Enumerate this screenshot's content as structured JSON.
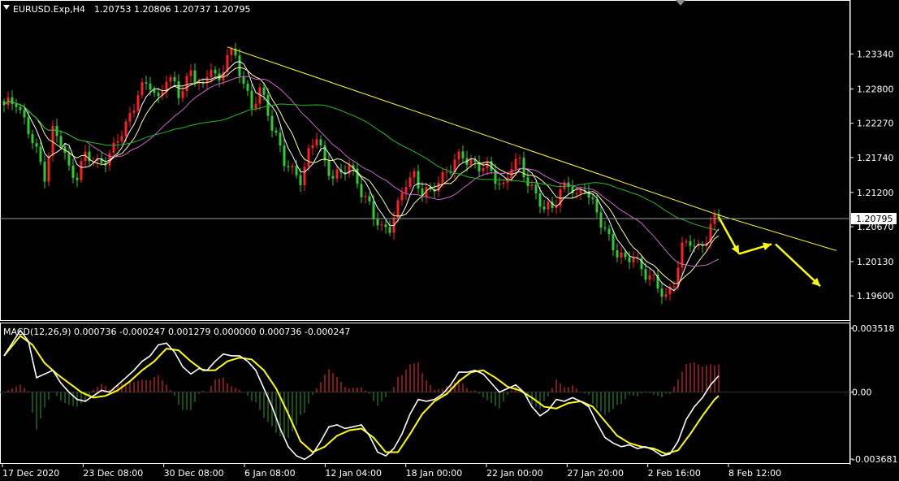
{
  "main_header": {
    "symbol": "EURUSD.Exp,H4",
    "ohlc": "1.20753 1.20806 1.20737 1.20795"
  },
  "macd_header": {
    "label": "MACD(12,26,9) 0.000736 -0.000247 0.001279 0.000000 0.000736 -0.000247"
  },
  "current_price": "1.20795",
  "colors": {
    "background": "#000000",
    "bull": "#ff2020",
    "bear": "#2ecc2e",
    "ma_fast": "#ffffff",
    "ma_mid": "#ffff99",
    "ma_slow": "#cc66cc",
    "ma_long": "#22bb22",
    "trendline": "#ffff33",
    "arrows": "#ffff00",
    "macd_line": "#ffffff",
    "signal_line": "#ffff00",
    "hist_pos": "#aa2222",
    "hist_neg": "#1f6b1f"
  },
  "chart_data": [
    {
      "type": "candlestick",
      "title": "EURUSD.Exp,H4",
      "price_ticks": [
        "1.23340",
        "1.22800",
        "1.22270",
        "1.21740",
        "1.21200",
        "1.20670",
        "1.20130",
        "1.19600"
      ],
      "ylim": [
        1.193,
        1.239
      ],
      "time_ticks": [
        "17 Dec 2020",
        "23 Dec 08:00",
        "30 Dec 08:00",
        "6 Jan 08:00",
        "12 Jan 04:00",
        "18 Jan 00:00",
        "22 Jan 00:00",
        "27 Jan 20:00",
        "2 Feb 16:00",
        "8 Feb 12:00"
      ],
      "close_anchors": [
        [
          0,
          1.225
        ],
        [
          3,
          1.2265
        ],
        [
          5,
          1.223
        ],
        [
          8,
          1.218
        ],
        [
          10,
          1.215
        ],
        [
          12,
          1.2215
        ],
        [
          14,
          1.2195
        ],
        [
          16,
          1.2155
        ],
        [
          18,
          1.215
        ],
        [
          20,
          1.2175
        ],
        [
          23,
          1.2165
        ],
        [
          27,
          1.2185
        ],
        [
          30,
          1.2225
        ],
        [
          33,
          1.2275
        ],
        [
          36,
          1.2285
        ],
        [
          38,
          1.2265
        ],
        [
          40,
          1.23
        ],
        [
          43,
          1.227
        ],
        [
          46,
          1.231
        ],
        [
          49,
          1.2275
        ],
        [
          51,
          1.232
        ],
        [
          53,
          1.229
        ],
        [
          55,
          1.2335
        ],
        [
          57,
          1.2325
        ],
        [
          59,
          1.2295
        ],
        [
          61,
          1.225
        ],
        [
          63,
          1.2275
        ],
        [
          65,
          1.2245
        ],
        [
          67,
          1.221
        ],
        [
          69,
          1.2165
        ],
        [
          71,
          1.215
        ],
        [
          73,
          1.2145
        ],
        [
          75,
          1.218
        ],
        [
          77,
          1.2205
        ],
        [
          79,
          1.2165
        ],
        [
          81,
          1.215
        ],
        [
          83,
          1.2145
        ],
        [
          85,
          1.216
        ],
        [
          87,
          1.214
        ],
        [
          89,
          1.211
        ],
        [
          91,
          1.208
        ],
        [
          93,
          1.2065
        ],
        [
          95,
          1.207
        ],
        [
          97,
          1.2095
        ],
        [
          99,
          1.2135
        ],
        [
          101,
          1.215
        ],
        [
          103,
          1.212
        ],
        [
          105,
          1.2115
        ],
        [
          107,
          1.214
        ],
        [
          109,
          1.2155
        ],
        [
          111,
          1.2165
        ],
        [
          113,
          1.2175
        ],
        [
          115,
          1.217
        ],
        [
          117,
          1.216
        ],
        [
          119,
          1.2155
        ],
        [
          121,
          1.2145
        ],
        [
          123,
          1.213
        ],
        [
          125,
          1.216
        ],
        [
          127,
          1.2165
        ],
        [
          129,
          1.214
        ],
        [
          131,
          1.2115
        ],
        [
          133,
          1.209
        ],
        [
          135,
          1.21
        ],
        [
          137,
          1.2125
        ],
        [
          139,
          1.213
        ],
        [
          141,
          1.211
        ],
        [
          143,
          1.2135
        ],
        [
          145,
          1.21
        ],
        [
          147,
          1.207
        ],
        [
          149,
          1.205
        ],
        [
          151,
          1.203
        ],
        [
          153,
          1.201
        ],
        [
          155,
          1.202
        ],
        [
          157,
          1.2005
        ],
        [
          159,
          1.199
        ],
        [
          161,
          1.197
        ],
        [
          163,
          1.196
        ],
        [
          165,
          1.1985
        ],
        [
          167,
          1.203
        ],
        [
          169,
          1.2045
        ],
        [
          171,
          1.2035
        ],
        [
          173,
          1.205
        ],
        [
          175,
          1.2075
        ],
        [
          176,
          1.2079
        ]
      ],
      "trendline": [
        [
          55,
          1.2345
        ],
        [
          176,
          1.2085
        ],
        [
          205,
          1.203
        ]
      ],
      "forecast_arrows": [
        [
          [
            176,
            1.2082
          ],
          [
            181,
            1.2025
          ]
        ],
        [
          [
            181,
            1.2025
          ],
          [
            189,
            1.204
          ]
        ],
        [
          [
            190,
            1.204
          ],
          [
            201,
            1.1975
          ]
        ]
      ]
    },
    {
      "type": "histogram+line",
      "title": "MACD(12,26,9)",
      "scale_ticks": [
        "0.003518",
        "0.00",
        "-0.003681"
      ],
      "ylim": [
        -0.003681,
        0.003518
      ],
      "macd_anchors": [
        [
          0,
          0.002
        ],
        [
          4,
          0.0034
        ],
        [
          6,
          0.0028
        ],
        [
          8,
          0.0008
        ],
        [
          10,
          0.001
        ],
        [
          12,
          0.0012
        ],
        [
          14,
          0.0005
        ],
        [
          16,
          0.0
        ],
        [
          18,
          -0.0004
        ],
        [
          20,
          -0.0005
        ],
        [
          22,
          -0.0002
        ],
        [
          24,
          0.0001
        ],
        [
          26,
          0.0
        ],
        [
          28,
          0.0004
        ],
        [
          30,
          0.0008
        ],
        [
          32,
          0.0012
        ],
        [
          34,
          0.0017
        ],
        [
          36,
          0.002
        ],
        [
          38,
          0.0026
        ],
        [
          40,
          0.0027
        ],
        [
          42,
          0.0022
        ],
        [
          44,
          0.0014
        ],
        [
          46,
          0.001
        ],
        [
          48,
          0.0013
        ],
        [
          50,
          0.0012
        ],
        [
          52,
          0.0017
        ],
        [
          54,
          0.0021
        ],
        [
          56,
          0.002
        ],
        [
          58,
          0.002
        ],
        [
          60,
          0.0017
        ],
        [
          62,
          0.0012
        ],
        [
          64,
          0.0002
        ],
        [
          66,
          -0.0008
        ],
        [
          68,
          -0.002
        ],
        [
          70,
          -0.003
        ],
        [
          72,
          -0.0035
        ],
        [
          74,
          -0.0037
        ],
        [
          76,
          -0.0034
        ],
        [
          78,
          -0.0027
        ],
        [
          80,
          -0.0019
        ],
        [
          82,
          -0.0018
        ],
        [
          84,
          -0.002
        ],
        [
          86,
          -0.0019
        ],
        [
          88,
          -0.0018
        ],
        [
          90,
          -0.0024
        ],
        [
          92,
          -0.0033
        ],
        [
          94,
          -0.0035
        ],
        [
          96,
          -0.0031
        ],
        [
          98,
          -0.0023
        ],
        [
          100,
          -0.0012
        ],
        [
          102,
          -0.0004
        ],
        [
          104,
          -0.0005
        ],
        [
          106,
          -0.0004
        ],
        [
          108,
          -0.0001
        ],
        [
          110,
          0.0004
        ],
        [
          112,
          0.0011
        ],
        [
          114,
          0.0011
        ],
        [
          116,
          0.0012
        ],
        [
          118,
          0.001
        ],
        [
          120,
          0.0005
        ],
        [
          122,
          0.0
        ],
        [
          124,
          0.0002
        ],
        [
          126,
          0.0004
        ],
        [
          128,
          0.0
        ],
        [
          130,
          -0.0008
        ],
        [
          132,
          -0.0013
        ],
        [
          134,
          -0.001
        ],
        [
          136,
          -0.0004
        ],
        [
          138,
          -0.0005
        ],
        [
          140,
          -0.0003
        ],
        [
          142,
          -0.0005
        ],
        [
          144,
          -0.0008
        ],
        [
          146,
          -0.0017
        ],
        [
          148,
          -0.0025
        ],
        [
          150,
          -0.0028
        ],
        [
          152,
          -0.003
        ],
        [
          154,
          -0.0029
        ],
        [
          156,
          -0.0031
        ],
        [
          158,
          -0.003
        ],
        [
          160,
          -0.0032
        ],
        [
          162,
          -0.0035
        ],
        [
          164,
          -0.0034
        ],
        [
          166,
          -0.0027
        ],
        [
          168,
          -0.0015
        ],
        [
          170,
          -0.0008
        ],
        [
          172,
          -0.0003
        ],
        [
          174,
          0.0004
        ],
        [
          176,
          0.0009
        ]
      ],
      "signal_anchors": [
        [
          0,
          0.002
        ],
        [
          4,
          0.0031
        ],
        [
          7,
          0.0026
        ],
        [
          10,
          0.0016
        ],
        [
          13,
          0.001
        ],
        [
          16,
          0.0005
        ],
        [
          19,
          0.0
        ],
        [
          22,
          -0.0003
        ],
        [
          25,
          -0.0002
        ],
        [
          28,
          0.0001
        ],
        [
          31,
          0.0006
        ],
        [
          34,
          0.0012
        ],
        [
          37,
          0.0017
        ],
        [
          40,
          0.0024
        ],
        [
          43,
          0.0023
        ],
        [
          46,
          0.0017
        ],
        [
          49,
          0.0012
        ],
        [
          52,
          0.0012
        ],
        [
          55,
          0.0017
        ],
        [
          58,
          0.0019
        ],
        [
          61,
          0.0018
        ],
        [
          64,
          0.0012
        ],
        [
          67,
          0.0002
        ],
        [
          70,
          -0.0012
        ],
        [
          73,
          -0.0027
        ],
        [
          76,
          -0.0033
        ],
        [
          79,
          -0.003
        ],
        [
          82,
          -0.0024
        ],
        [
          85,
          -0.0021
        ],
        [
          88,
          -0.002
        ],
        [
          91,
          -0.0025
        ],
        [
          94,
          -0.0033
        ],
        [
          97,
          -0.0033
        ],
        [
          100,
          -0.0023
        ],
        [
          103,
          -0.0012
        ],
        [
          106,
          -0.0005
        ],
        [
          109,
          -0.0001
        ],
        [
          112,
          0.0006
        ],
        [
          115,
          0.0011
        ],
        [
          118,
          0.0012
        ],
        [
          121,
          0.0008
        ],
        [
          124,
          0.0003
        ],
        [
          127,
          0.0001
        ],
        [
          130,
          -0.0003
        ],
        [
          133,
          -0.0008
        ],
        [
          136,
          -0.0009
        ],
        [
          139,
          -0.0006
        ],
        [
          142,
          -0.0005
        ],
        [
          145,
          -0.0008
        ],
        [
          148,
          -0.0016
        ],
        [
          151,
          -0.0024
        ],
        [
          154,
          -0.0028
        ],
        [
          157,
          -0.003
        ],
        [
          160,
          -0.0031
        ],
        [
          163,
          -0.0034
        ],
        [
          166,
          -0.0032
        ],
        [
          169,
          -0.0023
        ],
        [
          172,
          -0.0013
        ],
        [
          175,
          -0.0004
        ],
        [
          176,
          -0.0002
        ]
      ]
    }
  ]
}
